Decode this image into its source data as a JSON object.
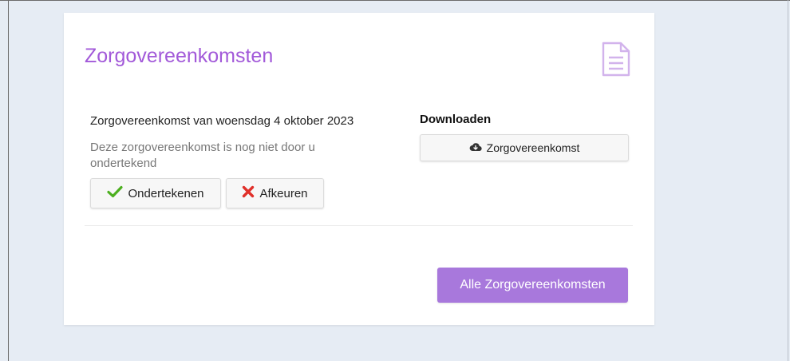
{
  "card": {
    "title": "Zorgovereenkomsten",
    "header_icon": "document-icon",
    "accent_color": "#a259d9"
  },
  "agreement": {
    "title": "Zorgovereenkomst van woensdag 4 oktober 2023",
    "status": "Deze zorgovereenkomst is nog niet door u ondertekend",
    "sign_label": "Ondertekenen",
    "sign_icon": "checkmark-icon",
    "reject_label": "Afkeuren",
    "reject_icon": "cross-icon"
  },
  "download": {
    "heading": "Downloaden",
    "button_label": "Zorgovereenkomst",
    "button_icon": "cloud-download-icon"
  },
  "footer": {
    "all_button_label": "Alle Zorgovereenkomsten",
    "all_button_color": "#a878dc"
  }
}
